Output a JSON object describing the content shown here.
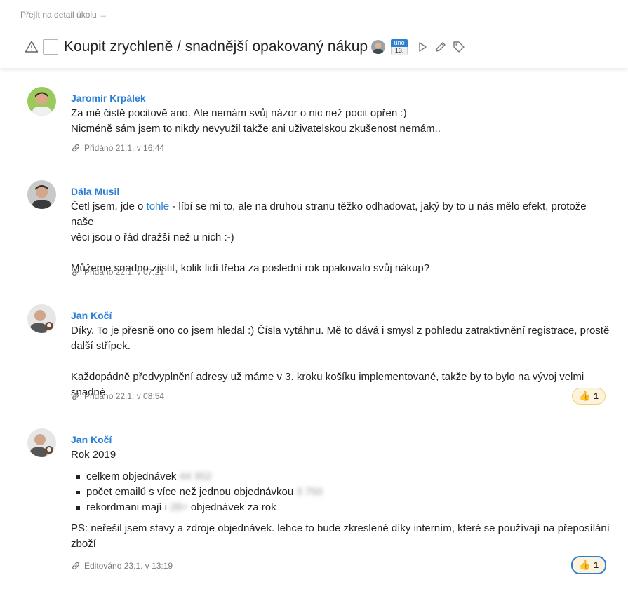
{
  "header": {
    "detail_link": "Přejít na detail úkolu →",
    "task_title": "Koupit zrychleně / snadnější opakovaný nákup",
    "due_month": "úno",
    "due_day": "13."
  },
  "comments": [
    {
      "author": "Jaromír Krpálek",
      "lines": [
        "Za mě čistě pocitově ano. Ale nemám svůj názor o nic než pocit opřen :)",
        "Nicméně sám jsem to nikdy nevyužil takže ani uživatelskou zkušenost nemám.."
      ],
      "meta": "Přidáno 21.1. v 16:44"
    },
    {
      "author": "Dála Musil",
      "p1_before": "Četl jsem, jde o ",
      "p1_link": "tohle",
      "p1_after_line1": " - líbí se mi to, ale na druhou stranu těžko odhadovat, jaký by to u nás mělo efekt, protože naše",
      "p1_line2": "věci jsou o řád dražší než u nich :-)",
      "p2": "Můžeme snadno zjistit, kolik lidí třeba za poslední rok opakovalo svůj nákup?",
      "meta": "Přidáno 22.1. v 07:21"
    },
    {
      "author": "Jan Kočí",
      "p1_line1": "Díky. To je přesně ono co jsem hledal :) Čísla vytáhnu. Mě to dává i smysl z pohledu zatraktivnění registrace, prostě",
      "p1_line2": "další střípek.",
      "p2": "Každopádně předvyplnění adresy už máme v 3. kroku košíku implementované, takže by to bylo na vývoj velmi snadné.",
      "meta": "Přidáno 22.1. v 08:54",
      "reaction_count": "1"
    },
    {
      "author": "Jan Kočí",
      "heading": "Rok 2019",
      "items": [
        {
          "text": "celkem objednávek ",
          "blurred": "44 352",
          "after": ""
        },
        {
          "text": "počet emailů s více než jednou objednávkou ",
          "blurred": "3 750",
          "after": ""
        },
        {
          "text": "rekordmani mají i ",
          "blurred": "28+",
          "after": " objednávek za rok"
        }
      ],
      "ps_line1": "PS: neřešil jsem stavy a zdroje objednávek. lehce to bude zkreslené díky interním, které se používají na přeposílání",
      "ps_line2": "zboží",
      "meta": "Editováno 23.1. v 13:19",
      "reaction_count": "1"
    }
  ],
  "icons": {
    "warning": "warning-icon",
    "play": "play-icon",
    "edit": "pencil-icon",
    "tag": "tag-icon",
    "link": "link-icon",
    "thumbs_up": "thumbs-up-icon"
  },
  "colors": {
    "accent": "#2a7fd4",
    "reaction_bg": "#fdf3dc"
  }
}
